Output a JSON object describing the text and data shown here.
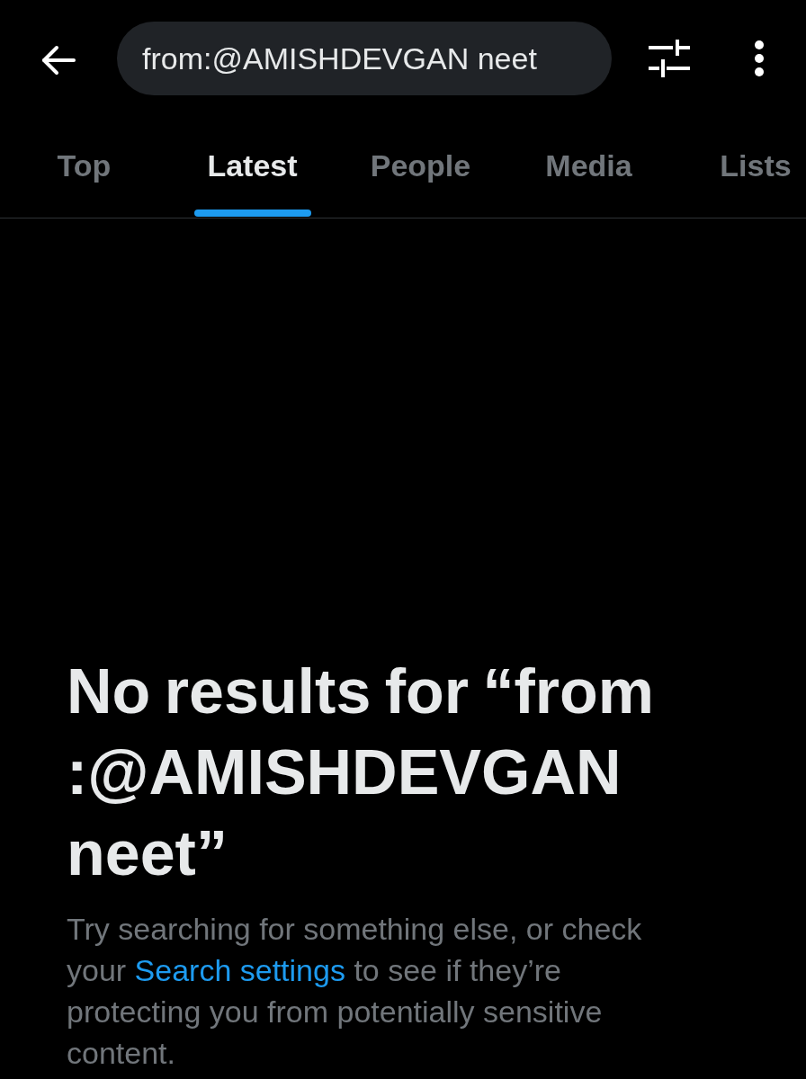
{
  "top_bar": {
    "search": {
      "value": "from:@AMISHDEVGAN neet"
    }
  },
  "tabs": [
    {
      "label": "Top",
      "selected": false
    },
    {
      "label": "Latest",
      "selected": true
    },
    {
      "label": "People",
      "selected": false
    },
    {
      "label": "Media",
      "selected": false
    },
    {
      "label": "Lists",
      "selected": false
    }
  ],
  "empty_state": {
    "title": "No results for “from:@AMISHDEVGAN neet”",
    "message": {
      "before": "Try searching for something else, or check your",
      "link": "Search settings",
      "after": "to see if they’re protecting you from potentially sensitive content."
    }
  }
}
